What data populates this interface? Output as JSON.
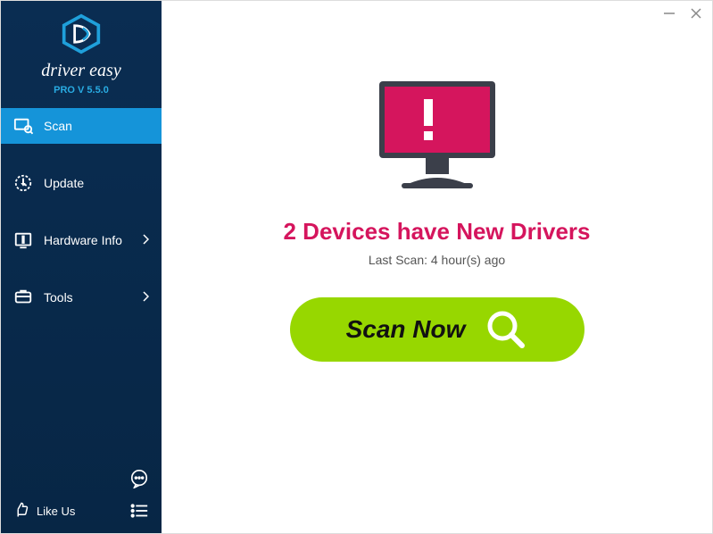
{
  "brand": {
    "name": "driver easy",
    "version_label": "PRO V 5.5.0"
  },
  "sidebar": {
    "items": [
      {
        "label": "Scan",
        "icon": "scan-icon",
        "active": true,
        "has_sub": false
      },
      {
        "label": "Update",
        "icon": "update-icon",
        "active": false,
        "has_sub": false
      },
      {
        "label": "Hardware Info",
        "icon": "hardware-icon",
        "active": false,
        "has_sub": true
      },
      {
        "label": "Tools",
        "icon": "tools-icon",
        "active": false,
        "has_sub": true
      }
    ],
    "like_us_label": "Like Us"
  },
  "main": {
    "status_headline": "2 Devices have New Drivers",
    "status_sub": "Last Scan: 4 hour(s) ago",
    "scan_button_label": "Scan Now"
  },
  "colors": {
    "accent_pink": "#d5155d",
    "accent_green": "#97d700",
    "accent_blue": "#1594d9",
    "sidebar_bg": "#0a2d52"
  }
}
